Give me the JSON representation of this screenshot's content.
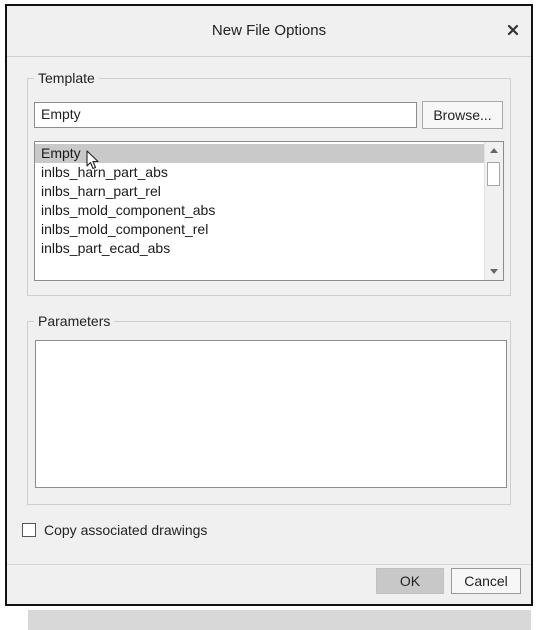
{
  "dialog": {
    "title": "New File Options",
    "close_icon": "close-icon"
  },
  "template": {
    "legend": "Template",
    "input_value": "Empty",
    "browse_label": "Browse...",
    "items": [
      {
        "label": "Empty",
        "selected": true
      },
      {
        "label": "inlbs_harn_part_abs"
      },
      {
        "label": "inlbs_harn_part_rel"
      },
      {
        "label": "inlbs_mold_component_abs"
      },
      {
        "label": "inlbs_mold_component_rel"
      },
      {
        "label": "inlbs_part_ecad_abs"
      }
    ]
  },
  "parameters": {
    "legend": "Parameters"
  },
  "copy_drawings": {
    "label": "Copy associated drawings",
    "checked": false
  },
  "footer": {
    "ok_label": "OK",
    "cancel_label": "Cancel"
  },
  "colors": {
    "dialog_bg": "#f0f0f0",
    "selection": "#c9c9c9",
    "ok_button": "#c8c8c8"
  }
}
